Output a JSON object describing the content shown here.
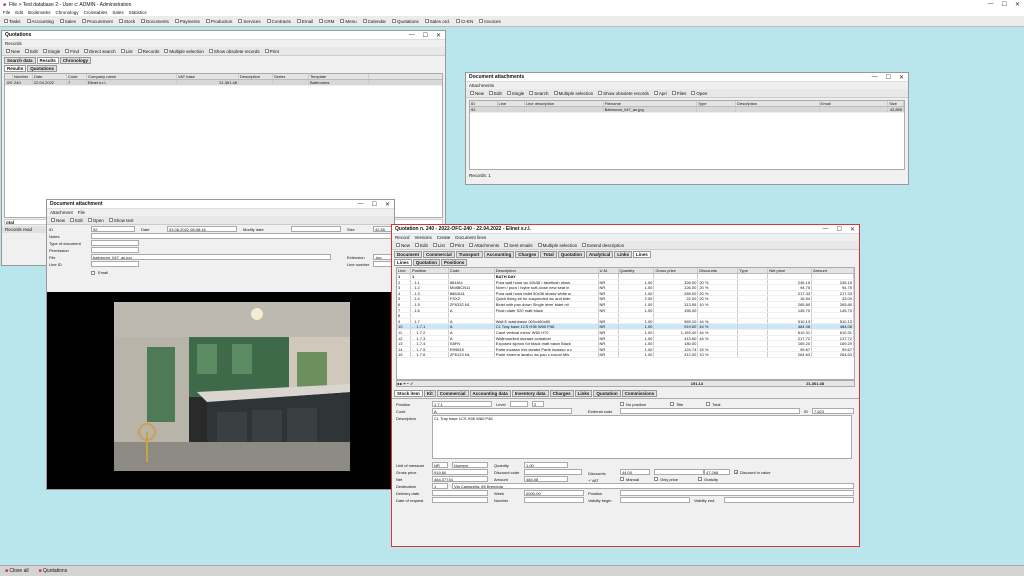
{
  "app": {
    "title": "File > Test database 2 - User c: ADMIN - Administration",
    "menu": [
      "File",
      "Edit",
      "Bookmarks",
      "Chronology",
      "Crosstables",
      "Sales",
      "Statistics"
    ],
    "modules": [
      "Tasks",
      "Accounting",
      "Sales",
      "Procurement",
      "Stock",
      "Documents",
      "Payments",
      "Production",
      "Services",
      "Contracts",
      "Email",
      "CRM",
      "Menu",
      "Calendar",
      "Quotations",
      "Sales ord.",
      "CI-EN",
      "Invoices"
    ]
  },
  "quotations_win": {
    "title": "Quotations",
    "menu": [
      "Records"
    ],
    "toolbar": [
      "New",
      "Edit",
      "Single",
      "Find",
      "Direct search",
      "List",
      "Records",
      "Multiple selection",
      "Show obsolete records",
      "Print"
    ],
    "tabs": [
      "Search data",
      "Results",
      "Chronology"
    ],
    "subtabs": [
      "Results",
      "Quotations"
    ],
    "columns": [
      "",
      "Number",
      "Date",
      "Code",
      "Company name",
      "VAT base",
      "Description",
      "Series",
      "Template"
    ],
    "row": [
      ".092",
      "240",
      "22.04.2022",
      "7",
      "Elinet s.r.l.",
      "21,361.48",
      "",
      "",
      "Bathrooms"
    ],
    "footer": "Records read",
    "footer_total": "otal"
  },
  "attachments_win": {
    "title": "Document attachments",
    "menu": [
      "Attachments"
    ],
    "toolbar": [
      "New",
      "Edit",
      "Single",
      "Search",
      "Multiple selection",
      "Show obsolete records",
      "Apri",
      "Files",
      "Open"
    ],
    "columns": [
      "ID",
      "Line",
      "Line description",
      "Filename",
      "Type",
      "Description",
      "Email",
      "Size"
    ],
    "row": [
      "92",
      "",
      "",
      "Bathroom_047_ac.jpg",
      "",
      "",
      "",
      "42,855"
    ],
    "footer": "Records: 1"
  },
  "doc_attach_win": {
    "title": "Document attachment",
    "menu": [
      "Attachment",
      "File"
    ],
    "toolbar": [
      "New",
      "Edit",
      "Open",
      "Show text"
    ],
    "labels": {
      "id": "ID",
      "date": "Date",
      "modify": "Modify date",
      "size": "Size",
      "notes": "Notes",
      "type": "Type of document",
      "perm": "Permission",
      "file": "File",
      "ext": "Extension",
      "lineid": "Line ID",
      "linenum": "Line number",
      "email": "Email"
    },
    "values": {
      "id": "92",
      "date": "03.06.2022 08:08:16",
      "size": "42,85",
      "file": "bathroom_047_ac.jpg",
      "ext": ".jpg"
    }
  },
  "quote_win": {
    "title": "Quotation n. 240 - 2022-OFC-240 - 22.04.2022 - Elinet s.r.l.",
    "menu": [
      "Record",
      "Versions",
      "Create",
      "Document lines"
    ],
    "toolbar": [
      "New",
      "Edit",
      "List",
      "Print",
      "Attachments",
      "Sent emails",
      "Multiple selection",
      "Extend description"
    ],
    "tabs": [
      "Document",
      "Commercial",
      "Transport",
      "Accounting",
      "Charges",
      "Total",
      "Quotation",
      "Analytical",
      "Links",
      "Lines"
    ],
    "subtabs": [
      "Lines",
      "Quotation",
      "Positions"
    ],
    "columns": [
      "Line",
      "Position",
      "Code",
      "Description",
      "U.M.",
      "Quantity",
      "Gross price",
      "Discounts",
      "Type",
      "Net price",
      "Amount"
    ],
    "rows": [
      [
        "1",
        "1",
        "",
        "BATH DAY",
        "",
        "",
        "",
        "",
        "",
        "",
        ""
      ],
      [
        "2",
        ". 1.1",
        "881611",
        "Pura wall hung wc 50x36 / faceflush gloss",
        "NR",
        "1.00",
        "326.00",
        "20 %",
        "",
        "245.15",
        "245.15"
      ],
      [
        "3",
        ". 1.2",
        "M08BCN11",
        "Norm / pura / Isybe soft-close new seat in",
        "NR",
        "1.00",
        "126.00",
        "20 %",
        "",
        "94.75",
        "94.75"
      ],
      [
        "4",
        ". 1.3",
        "8864111",
        "Pura wall hung bidet 50x36 glossy white w",
        "NR",
        "1.00",
        "289.00",
        "20 %",
        "",
        "217.33",
        "217.33"
      ],
      [
        "5",
        ". 1.4",
        "FSX2",
        "Quick fixing kit for suspended wc and bide",
        "NR",
        "2.00",
        "22.00",
        "20 %",
        "",
        "16.54",
        "33.09"
      ],
      [
        "6",
        ". 1.5",
        "ZF6332.N1",
        "Bidet with pan down Single lever bidet mi",
        "NR",
        "1.00",
        "313.95",
        "10 %",
        "",
        "265.80",
        "265.80"
      ],
      [
        "7",
        ". 1.6",
        "A",
        "Flush plate S20 matt black",
        "NR",
        "1.00",
        "155.00",
        "",
        "",
        "145.70",
        "145.70"
      ],
      [
        "8",
        "",
        "",
        "",
        "",
        "",
        "",
        "",
        "",
        "",
        ""
      ],
      [
        "9",
        ". 1.7",
        "A",
        "Wall E washbasin 000x460x80",
        "NR",
        "1.00",
        "969.10",
        "44 %",
        "",
        "510.13",
        "510.13"
      ],
      [
        "10",
        ". . 1.7.1",
        "A",
        "CL Tray base 1CS H36 W60 P46",
        "NR",
        "1.00",
        "919.60",
        "44 %",
        "",
        "484.08",
        "484.08"
      ],
      [
        "11",
        ". . 1.7.2",
        "A",
        "Canè vertical mirror W60 H70",
        "NR",
        "1.00",
        "1,159.40",
        "44 %",
        "",
        "610.31",
        "610.31"
      ],
      [
        "12",
        ". . 1.7.3",
        "A",
        "Wallmounted storage container",
        "NR",
        "1.00",
        "413.60",
        "44 %",
        "",
        "217.72",
        "217.72"
      ],
      [
        "13",
        ". . 1.7.4",
        "S8FN",
        "Exposed siphon for black matt basin Black",
        "NR",
        "1.00",
        "180.00",
        "",
        "",
        "169.20",
        "169.20"
      ],
      [
        "14",
        ". . 1.7.5",
        "R99815",
        "Parte incasso mix lavabo Parte incasso a c",
        "NR",
        "1.00",
        "124.74",
        "15 %",
        "",
        "99.67",
        "99.67"
      ],
      [
        "15",
        ". . 1.7.6",
        "ZF6123.N1",
        "Parte esterna lavabo inc.pan c.rosoni Mis",
        "NR",
        "1.00",
        "312.00",
        "10 %",
        "",
        "264.63",
        "264.63"
      ]
    ],
    "total_qty": "191.14",
    "total_amount": "21,361.48",
    "detail_tabs": [
      "Stock item",
      "Kit",
      "Commercial",
      "Accounting data",
      "Inventory data",
      "Charges",
      "Links",
      "Quotation",
      "Commissions"
    ],
    "detail": {
      "position_lbl": "Position",
      "position": "1.7.1",
      "level_lbl": "Level",
      "level": "2",
      "nopos": "No position",
      "title": "Title",
      "total": "Total",
      "code_lbl": "Code",
      "code": "A",
      "ext_code_lbl": "External code",
      "id_lbl": "ID",
      "id": "7,623",
      "desc_lbl": "Description",
      "desc": "CL Tray base 1CS H36 W60 P46",
      "uom_lbl": "Unit of measure",
      "uom": "NR",
      "uom2": "Numero",
      "qty_lbl": "Quantity",
      "qty": "1.00",
      "gross_lbl": "Gross price",
      "gross": "919.60",
      "doccode_lbl": "Discount code",
      "disc_lbl": "Discounts",
      "disc": "44.00",
      "disc_val": "47.268",
      "disc_in_value": "Discount in value",
      "net_lbl": "Net",
      "net": "484.07744",
      "amount_lbl": "Amount",
      "amount": "484.08",
      "vat_lbl": "+ VAT",
      "manual": "Manual",
      "only_price": "Only price",
      "gratuity": "Gratuity",
      "dest_lbl": "Destination",
      "dest": "1",
      "dest_addr": "Via Cantarella, 65 Brendola",
      "delivery_lbl": "Delivery date",
      "week_lbl": "Week",
      "week": "0000-00",
      "position2_lbl": "Position",
      "request_lbl": "Date of request",
      "number_lbl": "Number",
      "validity_lbl": "Validity begin",
      "validity_end_lbl": "Validity end"
    }
  },
  "taskbar": {
    "close_all": "Close all",
    "item": "Quotations"
  }
}
